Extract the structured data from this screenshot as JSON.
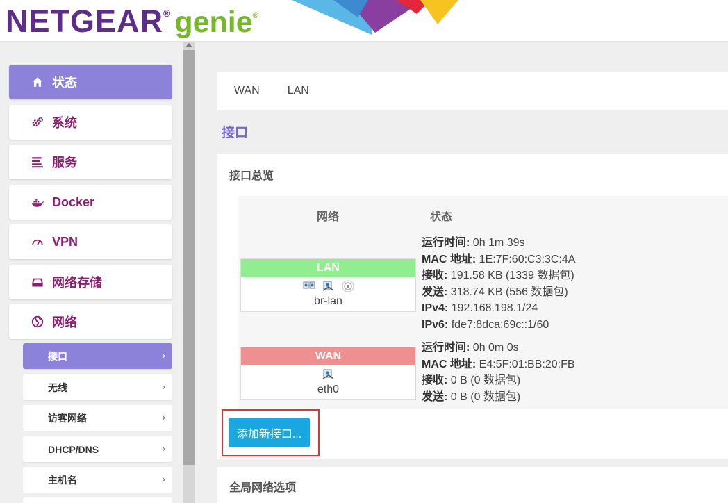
{
  "header": {
    "brand": "NETGEAR",
    "brand_reg": "®",
    "product": "genie",
    "product_tm": "®"
  },
  "sidebar": {
    "items": [
      {
        "label": "状态",
        "icon": "home-icon"
      },
      {
        "label": "系统",
        "icon": "gears-icon"
      },
      {
        "label": "服务",
        "icon": "list-icon"
      },
      {
        "label": "Docker",
        "icon": "docker-whale-icon"
      },
      {
        "label": "VPN",
        "icon": "speedometer-icon"
      },
      {
        "label": "网络存储",
        "icon": "drive-icon"
      },
      {
        "label": "网络",
        "icon": "globe-icon"
      }
    ],
    "sub_items": [
      {
        "label": "接口"
      },
      {
        "label": "无线"
      },
      {
        "label": "访客网络"
      },
      {
        "label": "DHCP/DNS"
      },
      {
        "label": "主机名"
      }
    ],
    "chevron": "›"
  },
  "tabs": [
    "WAN",
    "LAN"
  ],
  "page_title": "接口",
  "overview": {
    "title": "接口总览",
    "col_network": "网络",
    "col_status": "状态",
    "interfaces": [
      {
        "name": "LAN",
        "device": "br-lan",
        "color": "#90ee90",
        "status": [
          {
            "label": "运行时间:",
            "value": " 0h 1m 39s"
          },
          {
            "label": "MAC 地址:",
            "value": " 1E:7F:60:C3:3C:4A"
          },
          {
            "label": "接收:",
            "value": " 191.58 KB (1339 数据包)"
          },
          {
            "label": "发送:",
            "value": " 318.74 KB (556 数据包)"
          },
          {
            "label": "IPv4:",
            "value": " 192.168.198.1/24"
          },
          {
            "label": "IPv6:",
            "value": " fde7:8dca:69c::1/60"
          }
        ]
      },
      {
        "name": "WAN",
        "device": "eth0",
        "color": "#f08f8f",
        "status": [
          {
            "label": "运行时间:",
            "value": " 0h 0m 0s"
          },
          {
            "label": "MAC 地址:",
            "value": " E4:5F:01:BB:20:FB"
          },
          {
            "label": "接收:",
            "value": " 0 B (0 数据包)"
          },
          {
            "label": "发送:",
            "value": " 0 B (0 数据包)"
          }
        ]
      }
    ],
    "add_button": "添加新接口..."
  },
  "global_options": {
    "title": "全局网络选项"
  }
}
